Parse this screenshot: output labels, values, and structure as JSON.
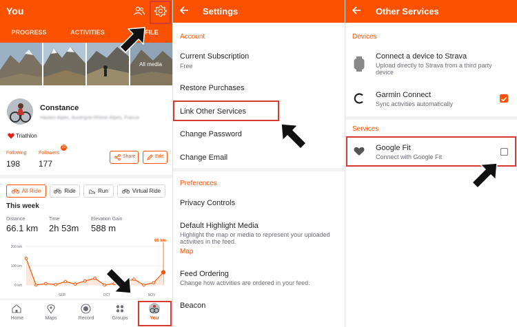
{
  "colors": {
    "brand": "#fc5200",
    "highlight": "#d63b2f",
    "heart": "#e0241b"
  },
  "you": {
    "title": "You",
    "tabs": [
      "PROGRESS",
      "ACTIVITIES",
      "FILE"
    ],
    "photo_label": "All media",
    "name": "Constance",
    "location": "Hautes-Alpes, Auvergne-Rhône-Alpes, France",
    "bio": "Triathlon",
    "following_label": "Following",
    "following_value": "198",
    "followers_label": "Followers",
    "followers_value": "177",
    "followers_badge": "23",
    "share_label": "Share",
    "edit_label": "Edit",
    "filters": [
      "All Ride",
      "Ride",
      "Run",
      "Virtual Ride"
    ],
    "week_title": "This week",
    "stats": [
      {
        "label": "Distance",
        "value": "66.1 km"
      },
      {
        "label": "Time",
        "value": "2h 53m"
      },
      {
        "label": "Elevation Gain",
        "value": "588 m"
      }
    ],
    "nav": [
      "Home",
      "Maps",
      "Record",
      "Groups",
      "You"
    ]
  },
  "chart_data": {
    "type": "line",
    "y_ticks": [
      "200 km",
      "100 km",
      "0 km"
    ],
    "x_ticks": [
      "SEP",
      "OCT",
      "NOV"
    ],
    "current_label": "66 km",
    "ylim": [
      0,
      200
    ],
    "values": [
      138,
      0,
      7,
      2,
      18,
      5,
      21,
      35,
      0,
      8,
      15,
      30,
      0,
      12,
      66
    ]
  },
  "settings": {
    "title": "Settings",
    "account_header": "Account",
    "current_subscription": "Current Subscription",
    "subscription_value": "Free",
    "restore": "Restore Purchases",
    "link_services": "Link Other Services",
    "change_password": "Change Password",
    "change_email": "Change Email",
    "preferences_header": "Preferences",
    "privacy": "Privacy Controls",
    "highlight_media": "Default Highlight Media",
    "highlight_media_sub": "Highlight the map or media to represent your uploaded activities in the feed.",
    "map_header": "Map",
    "feed_ordering": "Feed Ordering",
    "feed_ordering_sub": "Change how activities are ordered in your feed.",
    "beacon": "Beacon"
  },
  "services": {
    "title": "Other Services",
    "devices_header": "Devices",
    "connect_device": "Connect a device to Strava",
    "connect_device_sub": "Upload directly to Strava from a third party device",
    "garmin": "Garmin Connect",
    "garmin_sub": "Sync activities automatically",
    "services_header": "Services",
    "google_fit": "Google Fit",
    "google_fit_sub": "Connect with Google Fit"
  }
}
